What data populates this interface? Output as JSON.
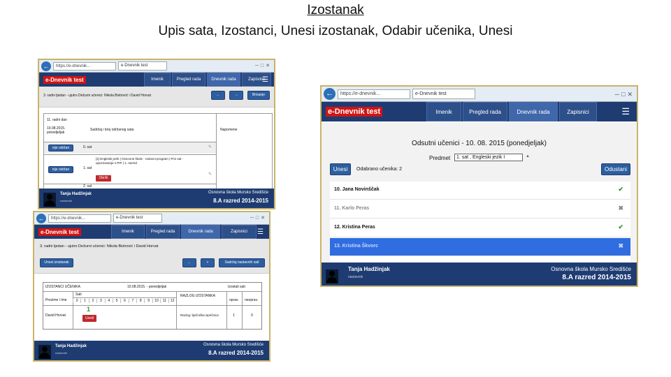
{
  "heading": {
    "title": "Izostanak",
    "subtitle": "Upis sata, Izostanci, Unesi izostanak, Odabir učenika, Unesi"
  },
  "colors": {
    "app_bar": "#1e3c72",
    "logo_bg": "#d11414",
    "accent_button": "#2d5fa0",
    "selected_row": "#2f6de0",
    "frame_border": "#c9b36a"
  },
  "common": {
    "url": "https://e-dnevnik...",
    "tab": "e-Dnevnik test",
    "logo": "e-Dnevnik test",
    "menu": [
      "Imenik",
      "Pregled rada",
      "Dnevnik rada",
      "Zapisnici"
    ],
    "user_name": "Tanja Hadžinjak",
    "user_role": "nastavnik",
    "school": "Osnovna škola Mursko Središće",
    "class": "8.A razred 2014-2015",
    "icons": [
      "back-arrow-icon",
      "forward-arrow-icon",
      "hamburger-icon",
      "avatar-icon",
      "check-icon",
      "cross-icon"
    ]
  },
  "shot1": {
    "info": "3. radni tjedan - ujutro   Dežurni učenici: Nikola Bistrović i David Horvat",
    "history_button": "Brisanje",
    "day_header": "11. radni dan",
    "date": "10.08.2015. ponedjeljak",
    "content_header": "Sadržaj i broj održanog sata",
    "notes_header": "Napomene",
    "rows": [
      {
        "button": "nije održan",
        "hour": "0. sat",
        "content": ""
      },
      {
        "button": "nije održan",
        "hour": "1. sat",
        "content": "[1] Engleski jezik | Osnovne škole - redovni program | Prvi sat - upoznavanje s PIP | 1. razred"
      },
      {
        "button": "",
        "hour": "2. sat",
        "content": ""
      }
    ],
    "delete_label": "Obriši"
  },
  "shot2": {
    "info": "3. radni tjedan - ujutro Dežurni učenici: Nikola Bistrović i David Horvat",
    "add_button": "Unesi izostanak",
    "history_button": "Sadržaj nastavnih sati",
    "table_title": "IZOSTANCI UČENIKA",
    "table_date": "10.08.2015. - ponedjeljak",
    "table_hours": "Izostali sati",
    "col_name": "Prezime i Ime",
    "col_sati": "Sati",
    "hours": [
      "0",
      "1",
      "2",
      "3",
      "4",
      "5",
      "6",
      "7",
      "8",
      "9",
      "10",
      "11",
      "12"
    ],
    "reason_header": "RAZLOG IZOSTANKA",
    "col_opravdano": "oprav.",
    "col_neopravdano": "neoprav.",
    "student": "David Horvat",
    "marked_hour": "1",
    "row_button": "Uredi",
    "reason": "Razlog: liječnička ispričnica",
    "oprav_value": "1",
    "neoprav_value": "0"
  },
  "shot3": {
    "heading": "Odsutni učenici - 10. 08. 2015 (ponedjeljak)",
    "subject_label": "Predmet",
    "subject_value": "1. sat , Engleski jezik I",
    "enter_button": "Unesi",
    "selected_count": "Odabrano učenika: 2",
    "cancel_button": "Odustani",
    "students": [
      {
        "name": "10. Jana Novinščak",
        "checked": true,
        "selected": false
      },
      {
        "name": "11. Karlo Peras",
        "checked": false,
        "selected": false
      },
      {
        "name": "12. Kristina Peras",
        "checked": true,
        "selected": false
      },
      {
        "name": "13. Kristina Škvorc",
        "checked": false,
        "selected": true
      }
    ]
  }
}
